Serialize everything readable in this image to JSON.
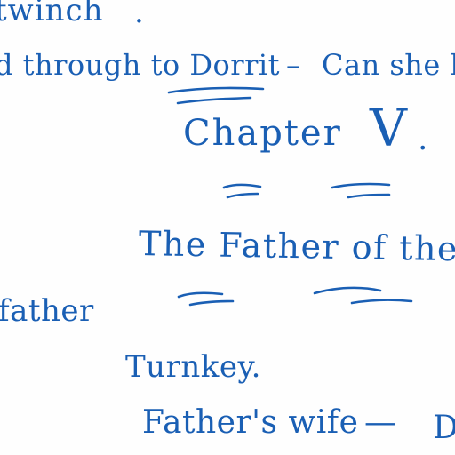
{
  "document": {
    "line1": {
      "text": "twinch",
      "dot": "."
    },
    "line2": {
      "text": "d through to Dorrit",
      "dash": "–",
      "tail": "Can she b"
    },
    "heading": {
      "chapter": "Chapter",
      "numeral": "V",
      "dot": "."
    },
    "title": "The Father of the M",
    "father": "father",
    "turnkey": "Turnkey.",
    "father_wife": {
      "text": "Father's wife",
      "dash": "—",
      "tail": "D"
    }
  },
  "ink_color": "#1a5fb4"
}
